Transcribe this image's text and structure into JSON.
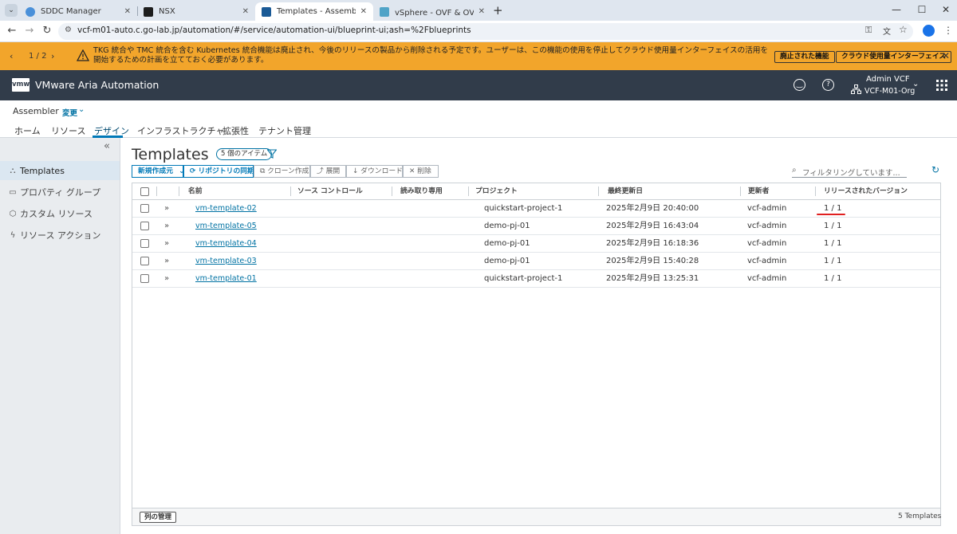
{
  "browser": {
    "tabs": [
      {
        "label": "SDDC Manager",
        "color": "#4a90d9",
        "active": false
      },
      {
        "label": "NSX",
        "color": "#1d1d1d",
        "active": false
      },
      {
        "label": "Templates - Assembler",
        "color": "#1a5a96",
        "active": true
      },
      {
        "label": "vSphere - OVF & OVA テンプレート",
        "color": "#4fa3c7",
        "active": false
      }
    ],
    "url": "vcf-m01-auto.c.go-lab.jp/automation/#/service/automation-ui/blueprint-ui;ash=%2Fblueprints"
  },
  "banner": {
    "pager": "1 / 2",
    "message": "TKG 統合や TMC 統合を含む Kubernetes 統合機能は廃止され、今後のリリースの製品から削除される予定です。ユーザーは、この機能の使用を停止してクラウド使用量インターフェイスの活用を開始するための計画を立てておく必要があります。",
    "btn_deprecated": "廃止された機能",
    "btn_cloud": "クラウド使用量インターフェイス"
  },
  "app": {
    "logo": "vmw",
    "title": "VMware Aria Automation",
    "user_name": "Admin VCF",
    "org": "VCF-M01-Org"
  },
  "context": {
    "name": "Assembler",
    "change": "変更"
  },
  "nav_tabs": [
    "ホーム",
    "リソース",
    "デザイン",
    "インフラストラクチャ",
    "拡張性",
    "テナント管理"
  ],
  "sidebar": {
    "items": [
      {
        "label": "Templates",
        "icon": "templates-icon"
      },
      {
        "label": "プロパティ グループ",
        "icon": "property-group-icon"
      },
      {
        "label": "カスタム リソース",
        "icon": "custom-resource-icon"
      },
      {
        "label": "リソース アクション",
        "icon": "resource-action-icon"
      }
    ]
  },
  "page": {
    "title": "Templates",
    "count_badge": "5 個のアイテム",
    "filter_placeholder": "フィルタリングしています..."
  },
  "toolbar": {
    "new": "新規作成元",
    "sync": "リポジトリの同期",
    "clone": "クローン作成",
    "deploy": "展開",
    "download": "ダウンロード",
    "delete": "削除"
  },
  "table": {
    "columns": [
      "名前",
      "ソース コントロール",
      "読み取り専用",
      "プロジェクト",
      "最終更新日",
      "更新者",
      "リリースされたバージョン"
    ],
    "rows": [
      {
        "name": "vm-template-02",
        "project": "quickstart-project-1",
        "updated": "2025年2月9日 20:40:00",
        "by": "vcf-admin",
        "version": "1 / 1"
      },
      {
        "name": "vm-template-05",
        "project": "demo-pj-01",
        "updated": "2025年2月9日 16:43:04",
        "by": "vcf-admin",
        "version": "1 / 1"
      },
      {
        "name": "vm-template-04",
        "project": "demo-pj-01",
        "updated": "2025年2月9日 16:18:36",
        "by": "vcf-admin",
        "version": "1 / 1"
      },
      {
        "name": "vm-template-03",
        "project": "demo-pj-01",
        "updated": "2025年2月9日 15:40:28",
        "by": "vcf-admin",
        "version": "1 / 1"
      },
      {
        "name": "vm-template-01",
        "project": "quickstart-project-1",
        "updated": "2025年2月9日 13:25:31",
        "by": "vcf-admin",
        "version": "1 / 1"
      }
    ],
    "manage_columns": "列の管理",
    "footer_count": "5 Templates"
  },
  "colors": {
    "banner": "#f2a52b",
    "header": "#313c4a",
    "accent": "#0072a3",
    "annotation": "#e02020"
  }
}
